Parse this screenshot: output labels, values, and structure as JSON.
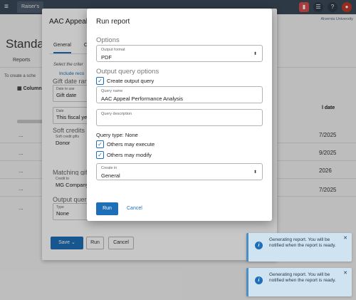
{
  "app_tab": "Raiser's",
  "org_name": "Alvernia University",
  "background": {
    "page_title": "Standa",
    "reports_tab": "Reports",
    "hint": "To create a sche",
    "columns": "Column",
    "rows": [
      "...",
      "...",
      "...",
      "...",
      "..."
    ],
    "right_header": "l date",
    "right_dates": [
      "7/2025",
      "9/2025",
      "2026",
      "7/2025"
    ]
  },
  "panel": {
    "title": "AAC Appeal F",
    "tab_general": "General",
    "tab_second": "C",
    "subtitle": "Select the criter",
    "link": "Include reco",
    "gift_date_section": "Gift date ran",
    "date_to_use_label": "Date to use",
    "date_to_use_value": "Gift date",
    "date_label": "Date",
    "date_value": "This fiscal ye",
    "soft_credits_section": "Soft credits",
    "soft_credit_label": "Soft credit gifts",
    "soft_credit_value": "Donor",
    "matching_section": "Matching gif",
    "credit_to_label": "Credit to",
    "credit_to_value": "MG Company",
    "output_query_section": "Output quer",
    "type_label": "Type",
    "type_value": "None",
    "save_label": "Save",
    "run_label": "Run",
    "cancel_label": "Cancel"
  },
  "modal": {
    "title": "Run report",
    "options_header": "Options",
    "output_format_label": "Output format",
    "output_format_value": "PDF",
    "output_query_header": "Output query options",
    "create_output_query": "Create output query",
    "query_name_label": "Query name",
    "query_name_value": "AAC Appeal Performance Analysis",
    "query_description_label": "Query description",
    "query_type_text": "Query type: None",
    "others_may_execute": "Others may execute",
    "others_may_modify": "Others may modify",
    "create_in_label": "Create in",
    "create_in_value": "General",
    "run_label": "Run",
    "cancel_label": "Cancel"
  },
  "toasts": [
    {
      "message": "Generating report. You will be notified when the report is ready."
    },
    {
      "message": "Generating report. You will be notified when the report is ready."
    }
  ],
  "colors": {
    "accent": "#1e6fb8",
    "topbar": "#3b4a5a",
    "toast_bg": "#cfe3f1"
  }
}
